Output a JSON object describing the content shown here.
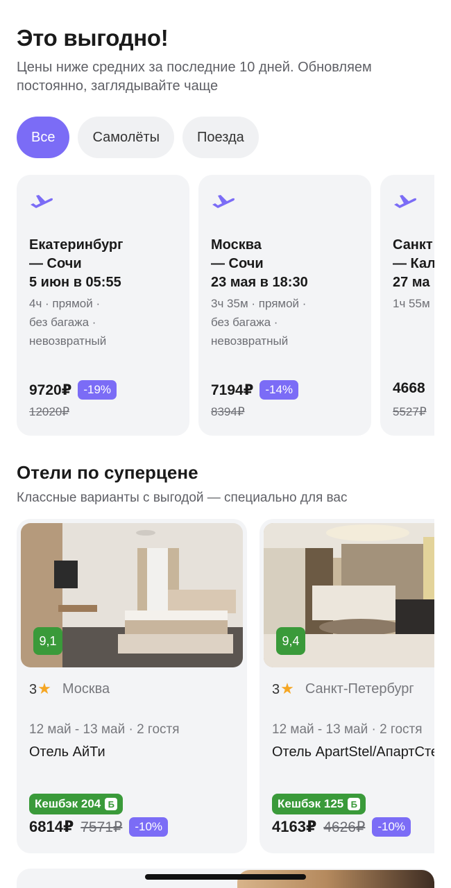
{
  "deals": {
    "title": "Это выгодно!",
    "subtitle": "Цены ниже средних за последние 10 дней. Обновляем постоянно, заглядывайте чаще",
    "filters": [
      "Все",
      "Самолёты",
      "Поезда"
    ],
    "active_filter": "Все",
    "cards": [
      {
        "icon": "plane-icon",
        "route": "Екатеринбург\n— Сочи\n5 июн в 05:55",
        "details": "4ч · прямой ·\nбез багажа ·\nневозвратный",
        "price": "9720₽",
        "discount": "-19%",
        "old_price": "12020₽"
      },
      {
        "icon": "plane-icon",
        "route": "Москва\n— Сочи\n23 мая в 18:30",
        "details": "3ч 35м · прямой ·\nбез багажа ·\nневозвратный",
        "price": "7194₽",
        "discount": "-14%",
        "old_price": "8394₽"
      },
      {
        "icon": "plane-icon",
        "route": "Санкт\n— Кал\n27 ма",
        "details": "1ч 55м",
        "price": "4668",
        "discount": "",
        "old_price": "5527₽"
      }
    ]
  },
  "hotels": {
    "title": "Отели по суперцене",
    "subtitle": "Классные варианты с выгодой — специально для вас",
    "cards": [
      {
        "rating": "9,1",
        "stars": "3",
        "city": "Москва",
        "dates": "12 май - 13 май · 2 гостя",
        "name": "Отель АйТи",
        "cashback": "Кешбэк 204",
        "cashback_icon": "Б",
        "price": "6814₽",
        "old_price": "7571₽",
        "discount": "-10%"
      },
      {
        "rating": "9,4",
        "stars": "3",
        "city": "Санкт-Петербург",
        "dates": "12 май - 13 май · 2 гостя",
        "name": "Отель ApartStel/АпартСтел",
        "cashback": "Кешбэк 125",
        "cashback_icon": "Б",
        "price": "4163₽",
        "old_price": "4626₽",
        "discount": "-10%"
      }
    ]
  },
  "colors": {
    "accent": "#7b6cf6",
    "cashback_green": "#3a9a3a",
    "card_bg": "#f3f4f6"
  }
}
